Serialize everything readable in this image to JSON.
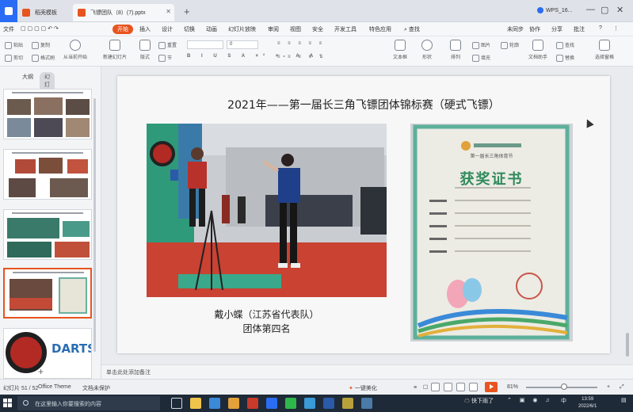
{
  "tabs": {
    "templates": "稻壳模板",
    "document": "飞镖团队（8）(7).pptx",
    "new_tab": "+",
    "account": "WPS_16..."
  },
  "menu": {
    "file": "文件",
    "items": [
      "开始",
      "插入",
      "设计",
      "切换",
      "动画",
      "幻灯片放映",
      "审阅",
      "视图",
      "安全",
      "开发工具",
      "特色应用"
    ],
    "search": "查找",
    "sync": "未同步",
    "collab": "协作",
    "share": "分享",
    "comment": "批注"
  },
  "ribbon": {
    "paste": "粘贴",
    "cut": "剪切",
    "copy": "复制",
    "format_painter": "格式刷",
    "play_from_current": "从当前开始",
    "new_slide": "新建幻灯片",
    "layout": "版式",
    "section": "节",
    "reset": "重置",
    "font_size": "0",
    "textbox": "文本框",
    "shape": "形状",
    "arrange": "排列",
    "replace": "替换",
    "pic": "图片",
    "fill": "填充",
    "outline": "轮廓",
    "find": "查找",
    "select": "选择",
    "text_tool": "文档助手",
    "select_pane": "选择窗格"
  },
  "leftpane": {
    "outline_tab": "大纲",
    "slides_tab": "幻灯片",
    "add": "+"
  },
  "slide": {
    "title": "2021年——第一届长三角飞镖团体锦标赛（硬式飞镖）",
    "caption_line1": "戴小蝶（江苏省代表队）",
    "caption_line2": "团体第四名",
    "certificate_title": "获奖证书",
    "certificate_header": "第一届长三角体育节",
    "darts_text": "DARTS"
  },
  "notes": {
    "placeholder": "单击此处添加备注"
  },
  "status": {
    "slide_count": "幻灯片 51 / 52",
    "theme": "Office Theme",
    "doc_protect": "文档未保护",
    "beautify": "一键美化",
    "zoom": "81%"
  },
  "taskbar": {
    "search_placeholder": "在这里输入你要搜索的内容",
    "weather": "快下雨了",
    "time": "13:59",
    "date": "2022/6/1",
    "lang": "中"
  },
  "colors": {
    "accent": "#e8541e",
    "blue": "#2a6df4",
    "taskbar": "#1f2a38"
  }
}
